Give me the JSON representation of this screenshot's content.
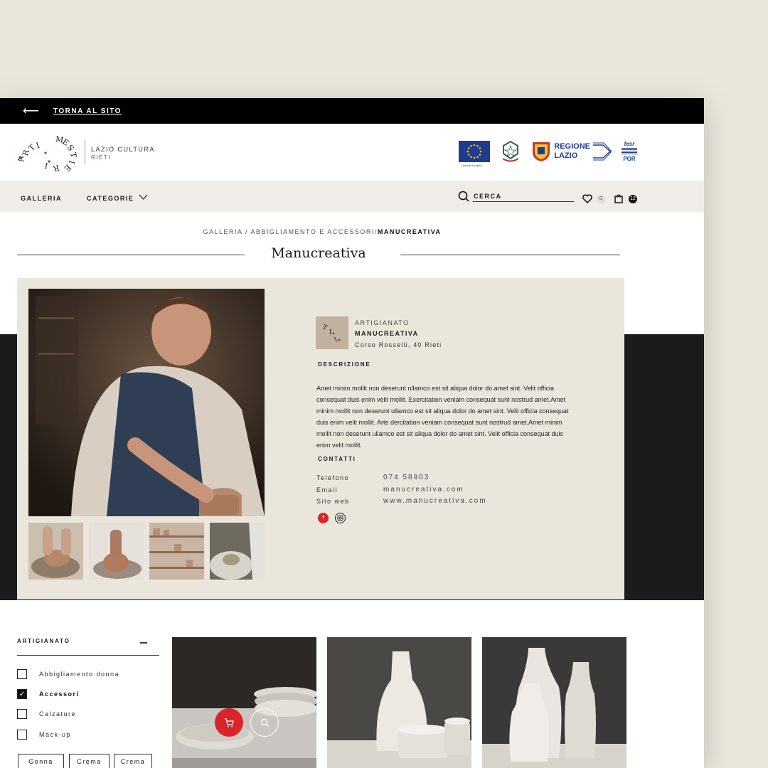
{
  "topbar": {
    "back_label": "TORNA AL SITO"
  },
  "brand": {
    "ring_letters": [
      "A",
      "R",
      "T",
      "I",
      "M",
      "E",
      "S",
      "T",
      "I",
      "E",
      "R",
      "I"
    ],
    "title": "LAZIO CULTURA",
    "subtitle": "RIETI"
  },
  "partner_logos": {
    "eu_caption": "Unione europea",
    "regione_line1": "REGIONE",
    "regione_line2": "LAZIO",
    "fesr_line1": "fesr",
    "fesr_line2": "POR"
  },
  "nav": {
    "galleria": "GALLERIA",
    "categorie": "CATEGORIE",
    "search_placeholder": "CERCA",
    "wishlist_count": "0",
    "cart_count": "12"
  },
  "breadcrumb": {
    "part1": "GALLERIA",
    "sep": " / ",
    "part2": "ABBIGLIAMENTO E ACCESSORI/",
    "current": "MANUCREATIVA"
  },
  "page_title": "Manucreativa",
  "vendor": {
    "category": "ARTIGIANATO",
    "name": "MANUCREATIVA",
    "address": "Corso Rosselli, 40 Rieti",
    "description_heading": "DESCRIZIONE",
    "description": "Amet minim mollit non deserunt ullamco est sit aliqua dolor do amet sint. Velit officia consequat duis enim velit mollit. Exercitation veniam consequat sunt nostrud amet.Amet minim mollit non deserunt ullamco est sit aliqua dolor do amet sint. Velit officia consequat duis enim velit mollit. Arte dercitation veniam consequat sunt nostrud amet.Amet minim mollit non deserunt ullamco est sit aliqua dolor do amet sint. Velit officia consequat duis enim velit mollit.",
    "contacts_heading": "CONTATTI",
    "phone_label": "Telefono",
    "phone": "074 58903",
    "email_label": "Email",
    "email": "manucreativa.com",
    "web_label": "Sito web",
    "web": "www.manucreativa.com",
    "social": [
      "facebook-icon",
      "instagram-icon"
    ]
  },
  "filters": {
    "title": "ARTIGIANATO",
    "items": [
      {
        "label": "Abbigliamento donna",
        "checked": false
      },
      {
        "label": "Accessori",
        "checked": true
      },
      {
        "label": "Calzature",
        "checked": false
      },
      {
        "label": "Mack-up",
        "checked": false
      }
    ],
    "tags": [
      "Gonna",
      "Crema",
      "Crema"
    ]
  },
  "colors": {
    "accent_red": "#d9252a",
    "sand": "#ebe6dc",
    "dark": "#1b1b1d"
  }
}
